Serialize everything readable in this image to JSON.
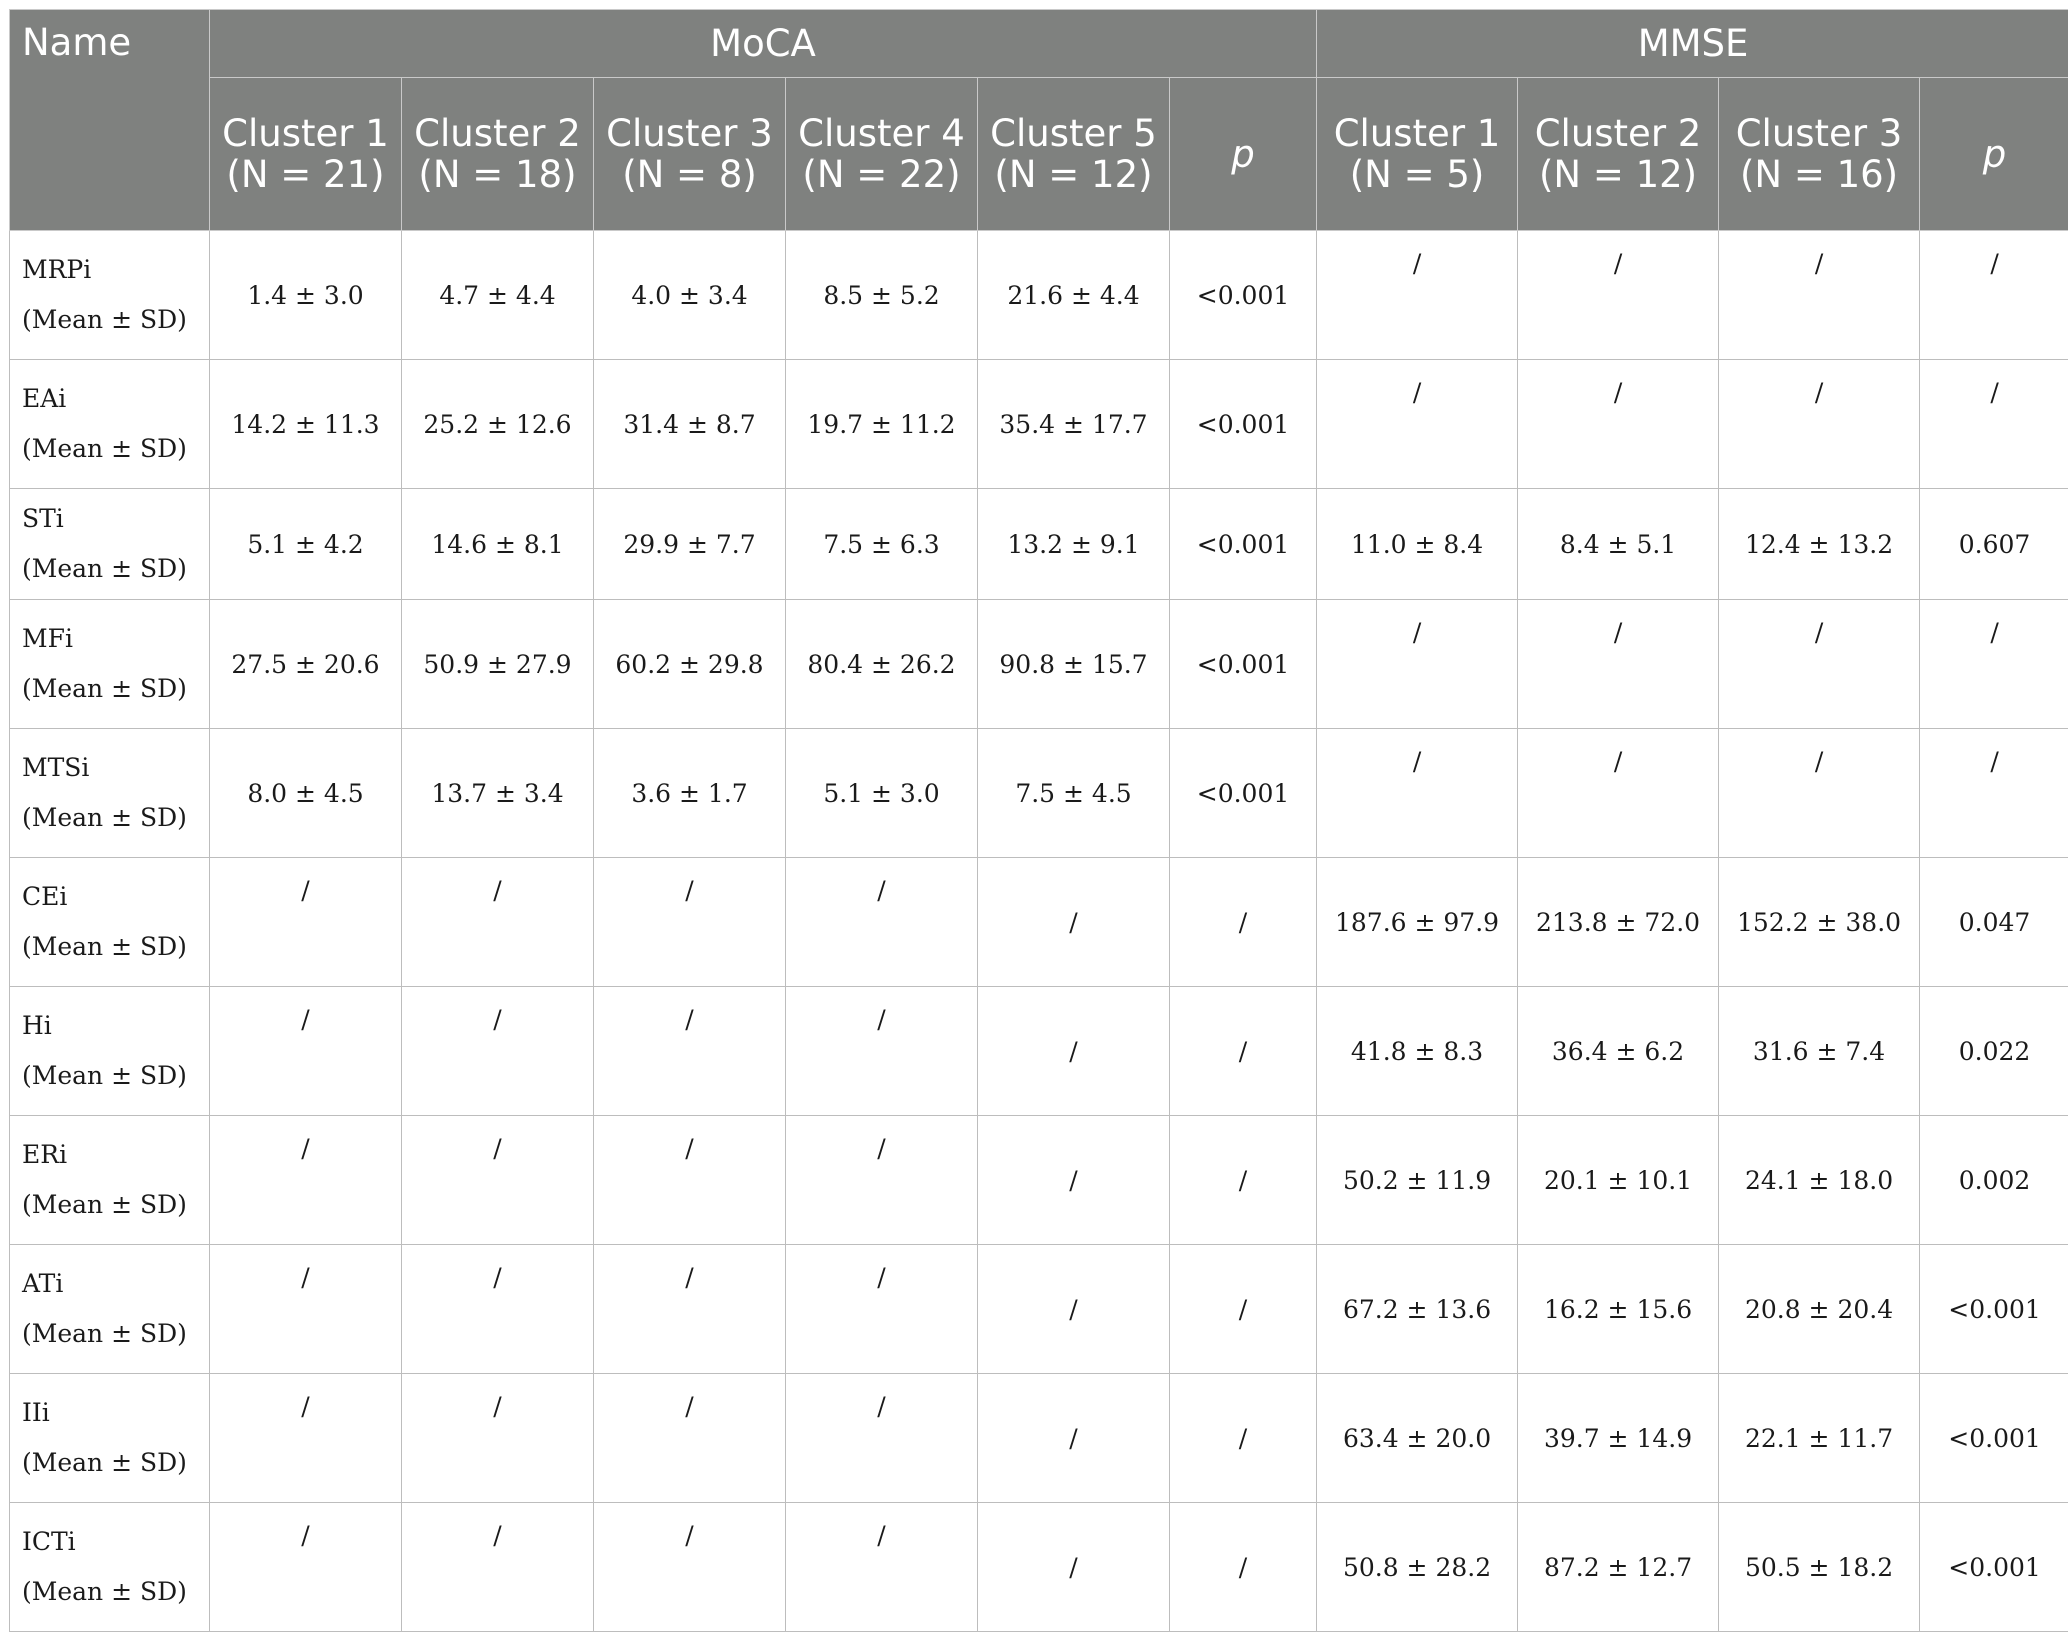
{
  "header": {
    "name": "Name",
    "moca": "MoCA",
    "mmse": "MMSE",
    "moca_columns": [
      {
        "label": "Cluster 1",
        "n": "(N = 21)"
      },
      {
        "label": "Cluster 2",
        "n": "(N = 18)"
      },
      {
        "label": "Cluster 3",
        "n": "(N = 8)"
      },
      {
        "label": "Cluster 4",
        "n": "(N = 22)"
      },
      {
        "label": "Cluster 5",
        "n": "(N = 12)"
      },
      {
        "label": "p"
      }
    ],
    "mmse_columns": [
      {
        "label": "Cluster 1",
        "n": "(N = 5)"
      },
      {
        "label": "Cluster 2",
        "n": "(N = 12)"
      },
      {
        "label": "Cluster 3",
        "n": "(N = 16)"
      },
      {
        "label": "p"
      }
    ]
  },
  "rows": [
    {
      "name": "MRPi",
      "stat": "(Mean ± SD)",
      "moca": [
        "1.4 ± 3.0",
        "4.7 ± 4.4",
        "4.0 ± 3.4",
        "8.5 ± 5.2",
        "21.6 ± 4.4",
        "<0.001"
      ],
      "mmse": [
        "/",
        "/",
        "/",
        "/"
      ]
    },
    {
      "name": "EAi",
      "stat": "(Mean ± SD)",
      "moca": [
        "14.2 ± 11.3",
        "25.2 ± 12.6",
        "31.4 ± 8.7",
        "19.7 ± 11.2",
        "35.4 ± 17.7",
        "<0.001"
      ],
      "mmse": [
        "/",
        "/",
        "/",
        "/"
      ]
    },
    {
      "name": "STi",
      "stat": "(Mean ± SD)",
      "moca": [
        "5.1 ± 4.2",
        "14.6 ± 8.1",
        "29.9 ± 7.7",
        "7.5 ± 6.3",
        "13.2 ± 9.1",
        "<0.001"
      ],
      "mmse": [
        "11.0 ± 8.4",
        "8.4 ± 5.1",
        "12.4 ± 13.2",
        "0.607"
      ]
    },
    {
      "name": "MFi",
      "stat": "(Mean ± SD)",
      "moca": [
        "27.5 ± 20.6",
        "50.9 ± 27.9",
        "60.2 ± 29.8",
        "80.4 ± 26.2",
        "90.8 ± 15.7",
        "<0.001"
      ],
      "mmse": [
        "/",
        "/",
        "/",
        "/"
      ]
    },
    {
      "name": "MTSi",
      "stat": "(Mean ± SD)",
      "moca": [
        "8.0 ± 4.5",
        "13.7 ± 3.4",
        "3.6 ± 1.7",
        "5.1 ± 3.0",
        "7.5 ± 4.5",
        "<0.001"
      ],
      "mmse": [
        "/",
        "/",
        "/",
        "/"
      ]
    },
    {
      "name": "CEi",
      "stat": "(Mean ± SD)",
      "moca": [
        "/",
        "/",
        "/",
        "/",
        "/",
        "/"
      ],
      "mmse": [
        "187.6 ± 97.9",
        "213.8 ± 72.0",
        "152.2 ± 38.0",
        "0.047"
      ]
    },
    {
      "name": "Hi",
      "stat": "(Mean ± SD)",
      "moca": [
        "/",
        "/",
        "/",
        "/",
        "/",
        "/"
      ],
      "mmse": [
        "41.8 ± 8.3",
        "36.4 ± 6.2",
        "31.6 ± 7.4",
        "0.022"
      ]
    },
    {
      "name": "ERi",
      "stat": "(Mean ± SD)",
      "moca": [
        "/",
        "/",
        "/",
        "/",
        "/",
        "/"
      ],
      "mmse": [
        "50.2 ± 11.9",
        "20.1 ± 10.1",
        "24.1 ± 18.0",
        "0.002"
      ]
    },
    {
      "name": "ATi",
      "stat": "(Mean ± SD)",
      "moca": [
        "/",
        "/",
        "/",
        "/",
        "/",
        "/"
      ],
      "mmse": [
        "67.2 ± 13.6",
        "16.2 ± 15.6",
        "20.8 ± 20.4",
        "<0.001"
      ]
    },
    {
      "name": "IIi",
      "stat": "(Mean ± SD)",
      "moca": [
        "/",
        "/",
        "/",
        "/",
        "/",
        "/"
      ],
      "mmse": [
        "63.4 ± 20.0",
        "39.7 ± 14.9",
        "22.1 ± 11.7",
        "<0.001"
      ]
    },
    {
      "name": "ICTi",
      "stat": "(Mean ± SD)",
      "moca": [
        "/",
        "/",
        "/",
        "/",
        "/",
        "/"
      ],
      "mmse": [
        "50.8 ± 28.2",
        "87.2 ± 12.7",
        "50.5 ± 18.2",
        "<0.001"
      ]
    }
  ]
}
